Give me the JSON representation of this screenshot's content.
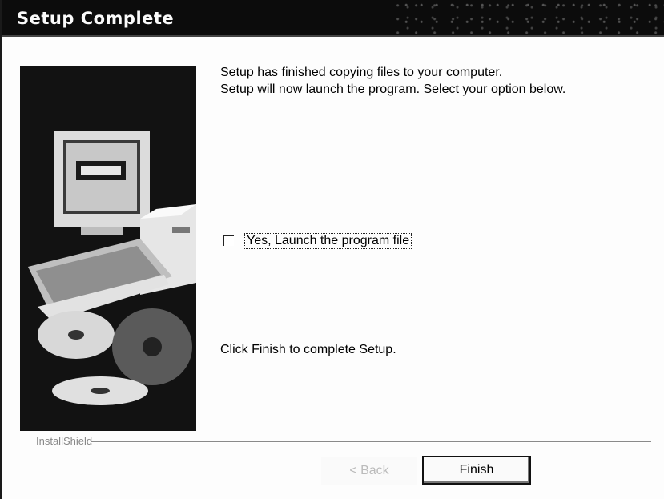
{
  "window": {
    "title": "Setup Complete"
  },
  "message": {
    "line1": "Setup has finished copying files to your computer.",
    "line2": "Setup will now launch the program. Select your option below."
  },
  "option": {
    "label": "Yes, Launch the program file",
    "checked": false
  },
  "instruction": "Click Finish to complete Setup.",
  "footer": {
    "brand": "InstallShield"
  },
  "buttons": {
    "back_label": "< Back",
    "finish_label": "Finish"
  },
  "image": {
    "icons": [
      "monitor-icon",
      "computer-case-icon",
      "keyboard-icon",
      "cd-disc-icon"
    ]
  },
  "colors": {
    "titlebar": "#0c0c0c",
    "title_text": "#fafafa"
  }
}
